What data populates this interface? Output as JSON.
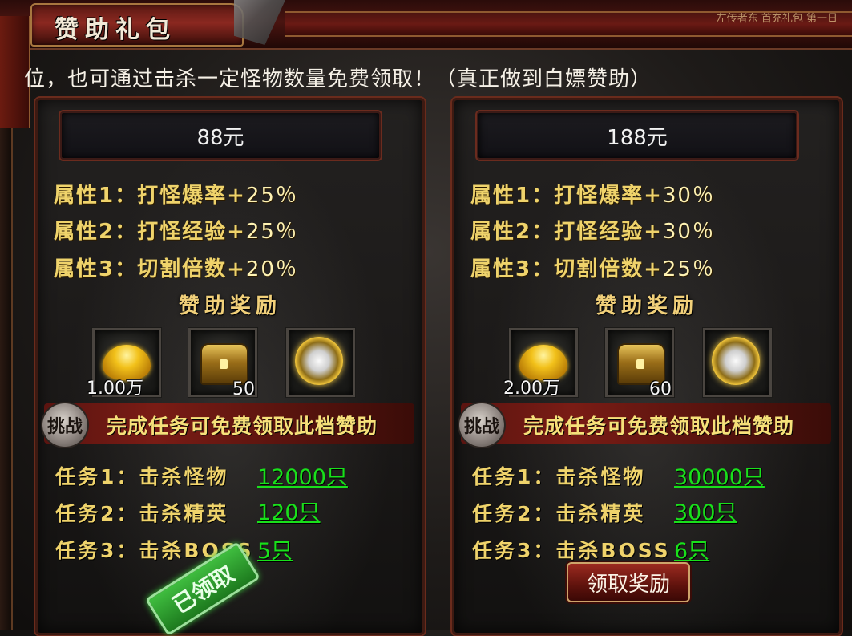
{
  "window": {
    "title": "赞助礼包",
    "top_right_text": "左传者东    首充礼包    第一日"
  },
  "notice": "位，也可通过击杀一定怪物数量免费领取！（真正做到白嫖赞助）",
  "panels": [
    {
      "price": "88元",
      "attributes": [
        {
          "label": "属性1：打怪爆率+",
          "value": "25％"
        },
        {
          "label": "属性2：打怪经验+",
          "value": "25％"
        },
        {
          "label": "属性3：切割倍数+",
          "value": "20％"
        }
      ],
      "reward_title": "赞助奖励",
      "rewards": [
        {
          "icon": "gold-ingot-icon",
          "count": "1.00万"
        },
        {
          "icon": "treasure-chest-icon",
          "count": "50"
        },
        {
          "icon": "dragon-emblem-icon",
          "count": ""
        }
      ],
      "challenge_tag": "挑战",
      "challenge_text": "完成任务可免费领取此档赞助",
      "tasks": [
        {
          "label": "任务1：击杀怪物",
          "value": "12000只"
        },
        {
          "label": "任务2：击杀精英",
          "value": "120只"
        },
        {
          "label": "任务3：击杀BOSS",
          "value": "5只"
        }
      ],
      "status": "已领取"
    },
    {
      "price": "188元",
      "attributes": [
        {
          "label": "属性1：打怪爆率+",
          "value": "30％"
        },
        {
          "label": "属性2：打怪经验+",
          "value": "30％"
        },
        {
          "label": "属性3：切割倍数+",
          "value": "25％"
        }
      ],
      "reward_title": "赞助奖励",
      "rewards": [
        {
          "icon": "gold-ingot-icon",
          "count": "2.00万"
        },
        {
          "icon": "treasure-chest-icon",
          "count": "60"
        },
        {
          "icon": "horse-emblem-icon",
          "count": ""
        }
      ],
      "challenge_tag": "挑战",
      "challenge_text": "完成任务可免费领取此档赞助",
      "tasks": [
        {
          "label": "任务1：击杀怪物",
          "value": "30000只"
        },
        {
          "label": "任务2：击杀精英",
          "value": "300只"
        },
        {
          "label": "任务3：击杀BOSS",
          "value": "6只"
        }
      ],
      "claim_button": "领取奖励"
    }
  ],
  "colors": {
    "attr_text": "#efd36b",
    "task_value": "#19e01b",
    "frame_red": "#6a2b1c"
  }
}
